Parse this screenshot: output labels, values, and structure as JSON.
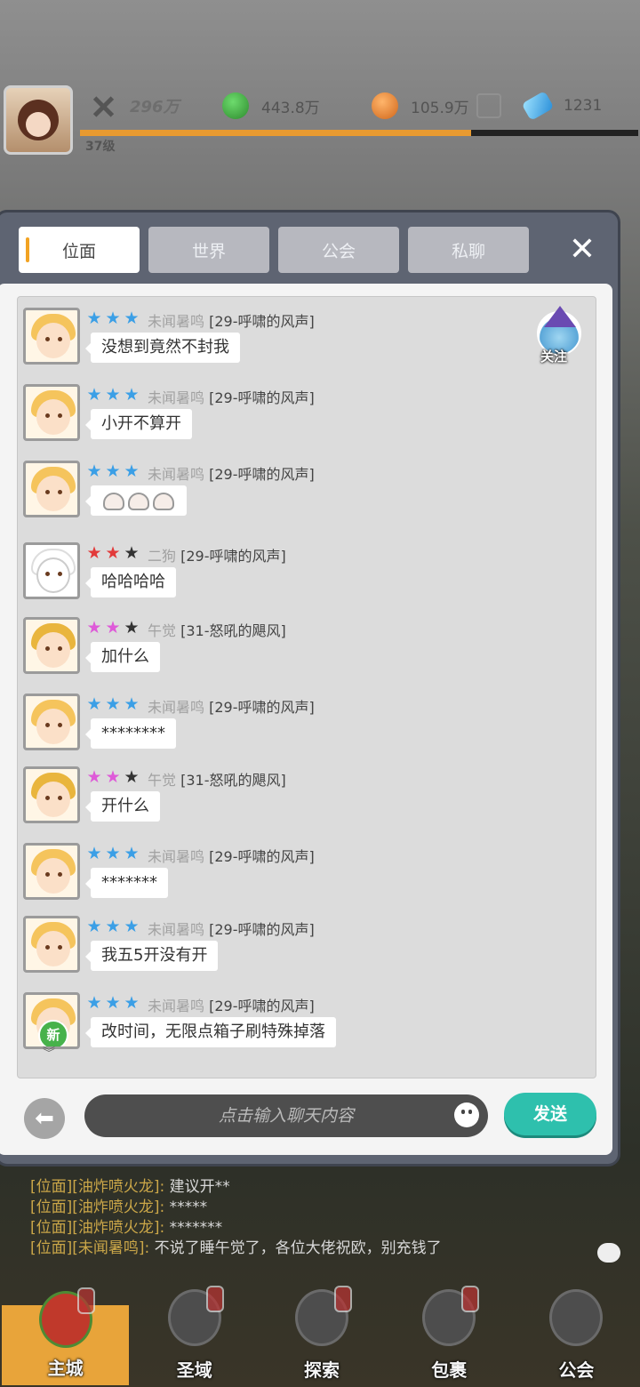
{
  "hud": {
    "power": "296万",
    "gold": "443.8万",
    "coin": "105.9万",
    "gem": "1231",
    "level": "37级",
    "xp_progress": 0.7
  },
  "tabs": [
    {
      "label": "位面",
      "active": true
    },
    {
      "label": "世界",
      "active": false
    },
    {
      "label": "公会",
      "active": false
    },
    {
      "label": "私聊",
      "active": false
    }
  ],
  "follow_label": "关注",
  "new_badge": "新",
  "messages": [
    {
      "name": "未闻暑鸣",
      "guild": "[29-呼啸的风声]",
      "text": "没想到竟然不封我",
      "stars": "blue3"
    },
    {
      "name": "未闻暑鸣",
      "guild": "[29-呼啸的风声]",
      "text": "小开不算开",
      "stars": "blue3"
    },
    {
      "name": "未闻暑鸣",
      "guild": "[29-呼啸的风声]",
      "text": "",
      "stars": "blue3",
      "emoji": 3
    },
    {
      "name": "二狗",
      "guild": "[29-呼啸的风声]",
      "text": "哈哈哈哈",
      "stars": "red2"
    },
    {
      "name": "午觉",
      "guild": "[31-怒吼的飓风]",
      "text": "加什么",
      "stars": "pink2"
    },
    {
      "name": "未闻暑鸣",
      "guild": "[29-呼啸的风声]",
      "text": "********",
      "stars": "blue3"
    },
    {
      "name": "午觉",
      "guild": "[31-怒吼的飓风]",
      "text": "开什么",
      "stars": "pink2"
    },
    {
      "name": "未闻暑鸣",
      "guild": "[29-呼啸的风声]",
      "text": "*******",
      "stars": "blue3"
    },
    {
      "name": "未闻暑鸣",
      "guild": "[29-呼啸的风声]",
      "text": "我五5开没有开",
      "stars": "blue3"
    },
    {
      "name": "未闻暑鸣",
      "guild": "[29-呼啸的风声]",
      "text": "改时间，无限点箱子刷特殊掉落",
      "stars": "blue3"
    }
  ],
  "input": {
    "placeholder": "点击输入聊天内容",
    "send_label": "发送"
  },
  "bg_log": [
    {
      "prefix": "[位面][油炸喷火龙]:",
      "text": "建议开**"
    },
    {
      "prefix": "[位面][油炸喷火龙]:",
      "text": "*****"
    },
    {
      "prefix": "[位面][油炸喷火龙]:",
      "text": "*******"
    },
    {
      "prefix": "[位面][未闻暑鸣]:",
      "text": "不说了睡午觉了，各位大佬祝欧，别充钱了"
    }
  ],
  "nav": [
    {
      "label": "主城",
      "active": true
    },
    {
      "label": "圣域",
      "active": false
    },
    {
      "label": "探索",
      "active": false
    },
    {
      "label": "包裹",
      "active": false
    },
    {
      "label": "公会",
      "active": false
    }
  ]
}
